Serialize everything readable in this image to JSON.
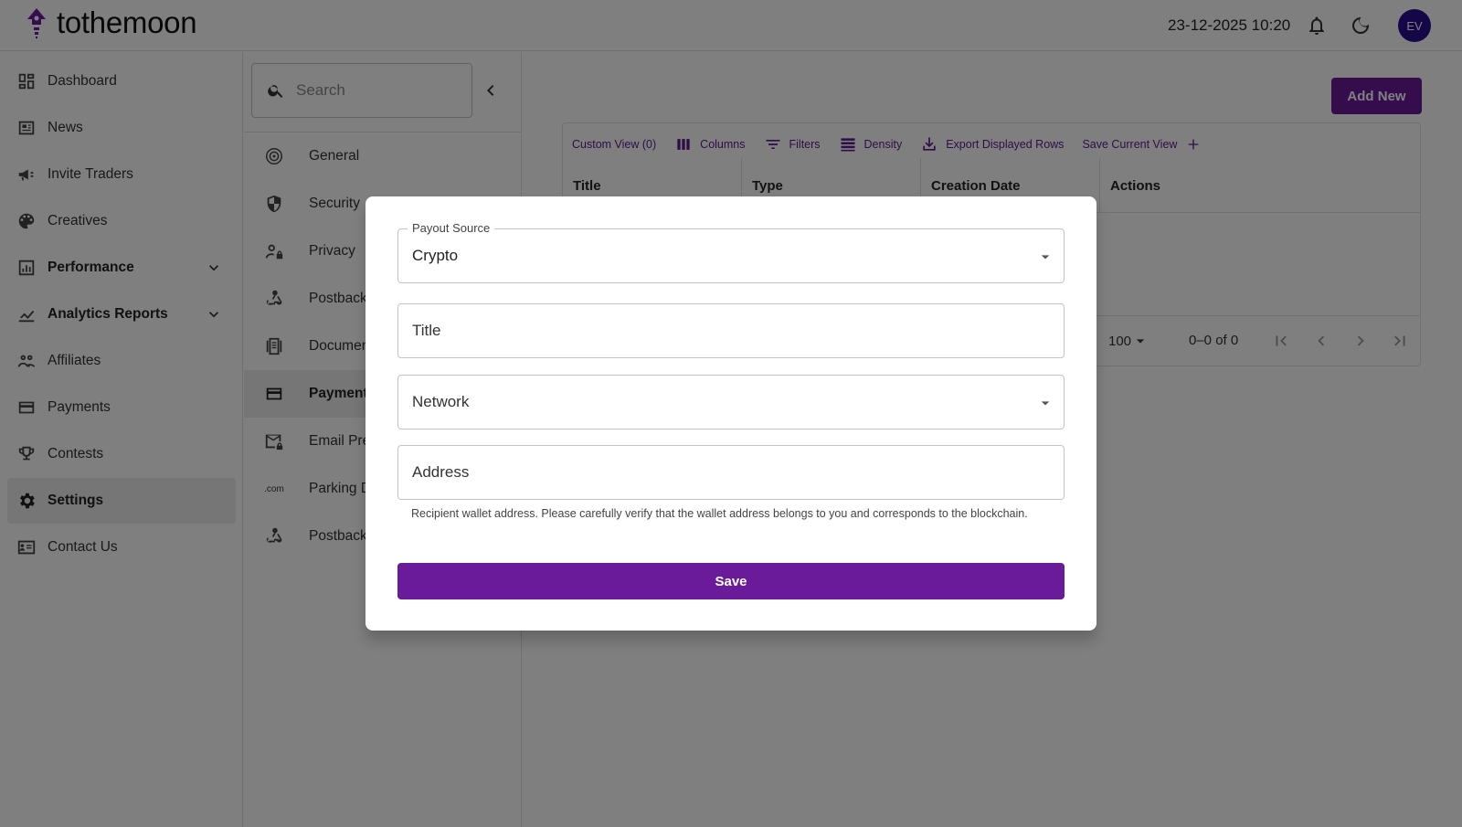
{
  "header": {
    "brand": "tothemoon",
    "datetime": "23-12-2025 10:20",
    "avatar_initials": "EV",
    "icons": [
      "logo-rocket-icon",
      "bell-icon",
      "moon-icon"
    ]
  },
  "sidebar": {
    "items": [
      {
        "label": "Dashboard",
        "icon": "dashboard-icon"
      },
      {
        "label": "News",
        "icon": "news-icon"
      },
      {
        "label": "Invite Traders",
        "icon": "megaphone-icon"
      },
      {
        "label": "Creatives",
        "icon": "palette-icon"
      },
      {
        "label": "Performance",
        "icon": "bar-chart-icon",
        "expandable": true
      },
      {
        "label": "Analytics Reports",
        "icon": "line-chart-icon",
        "expandable": true
      },
      {
        "label": "Affiliates",
        "icon": "group-icon"
      },
      {
        "label": "Payments",
        "icon": "credit-card-icon"
      },
      {
        "label": "Contests",
        "icon": "trophy-icon"
      },
      {
        "label": "Settings",
        "icon": "gear-icon",
        "active": true
      },
      {
        "label": "Contact Us",
        "icon": "contact-card-icon"
      }
    ]
  },
  "settings_menu": {
    "search_placeholder": "Search",
    "items": [
      {
        "label": "General",
        "icon": "target-icon"
      },
      {
        "label": "Security",
        "icon": "shield-icon"
      },
      {
        "label": "Privacy",
        "icon": "person-lock-icon"
      },
      {
        "label": "Postback",
        "icon": "webhook-icon"
      },
      {
        "label": "Documen",
        "icon": "document-icon"
      },
      {
        "label": "Payment",
        "icon": "credit-card-icon",
        "active": true
      },
      {
        "label": "Email Pre",
        "icon": "mail-lock-icon"
      },
      {
        "label": "Parking D",
        "icon": "dot-com-icon",
        "icon_text": ".com"
      },
      {
        "label": "Postback",
        "icon": "webhook-icon"
      }
    ]
  },
  "content": {
    "add_new_label": "Add New",
    "toolbar": {
      "custom_view": "Custom View (0)",
      "columns": "Columns",
      "filters": "Filters",
      "density": "Density",
      "export": "Export Displayed Rows",
      "save_view": "Save Current View"
    },
    "columns": [
      "Title",
      "Type",
      "Creation Date",
      "Actions"
    ],
    "rows": [],
    "pagination": {
      "page_size": "100",
      "range": "0–0 of 0"
    }
  },
  "modal": {
    "payout_source": {
      "label": "Payout Source",
      "value": "Crypto"
    },
    "title_field": {
      "placeholder": "Title",
      "value": ""
    },
    "network_field": {
      "placeholder": "Network",
      "value": ""
    },
    "address_field": {
      "placeholder": "Address",
      "value": ""
    },
    "address_helper": "Recipient wallet address. Please carefully verify that the wallet address belongs to you and corresponds to the blockchain.",
    "save_label": "Save"
  },
  "colors": {
    "brand": "#6a1b9a",
    "avatar": "#2a0c91",
    "toolbar_text": "#5b1a8c"
  }
}
